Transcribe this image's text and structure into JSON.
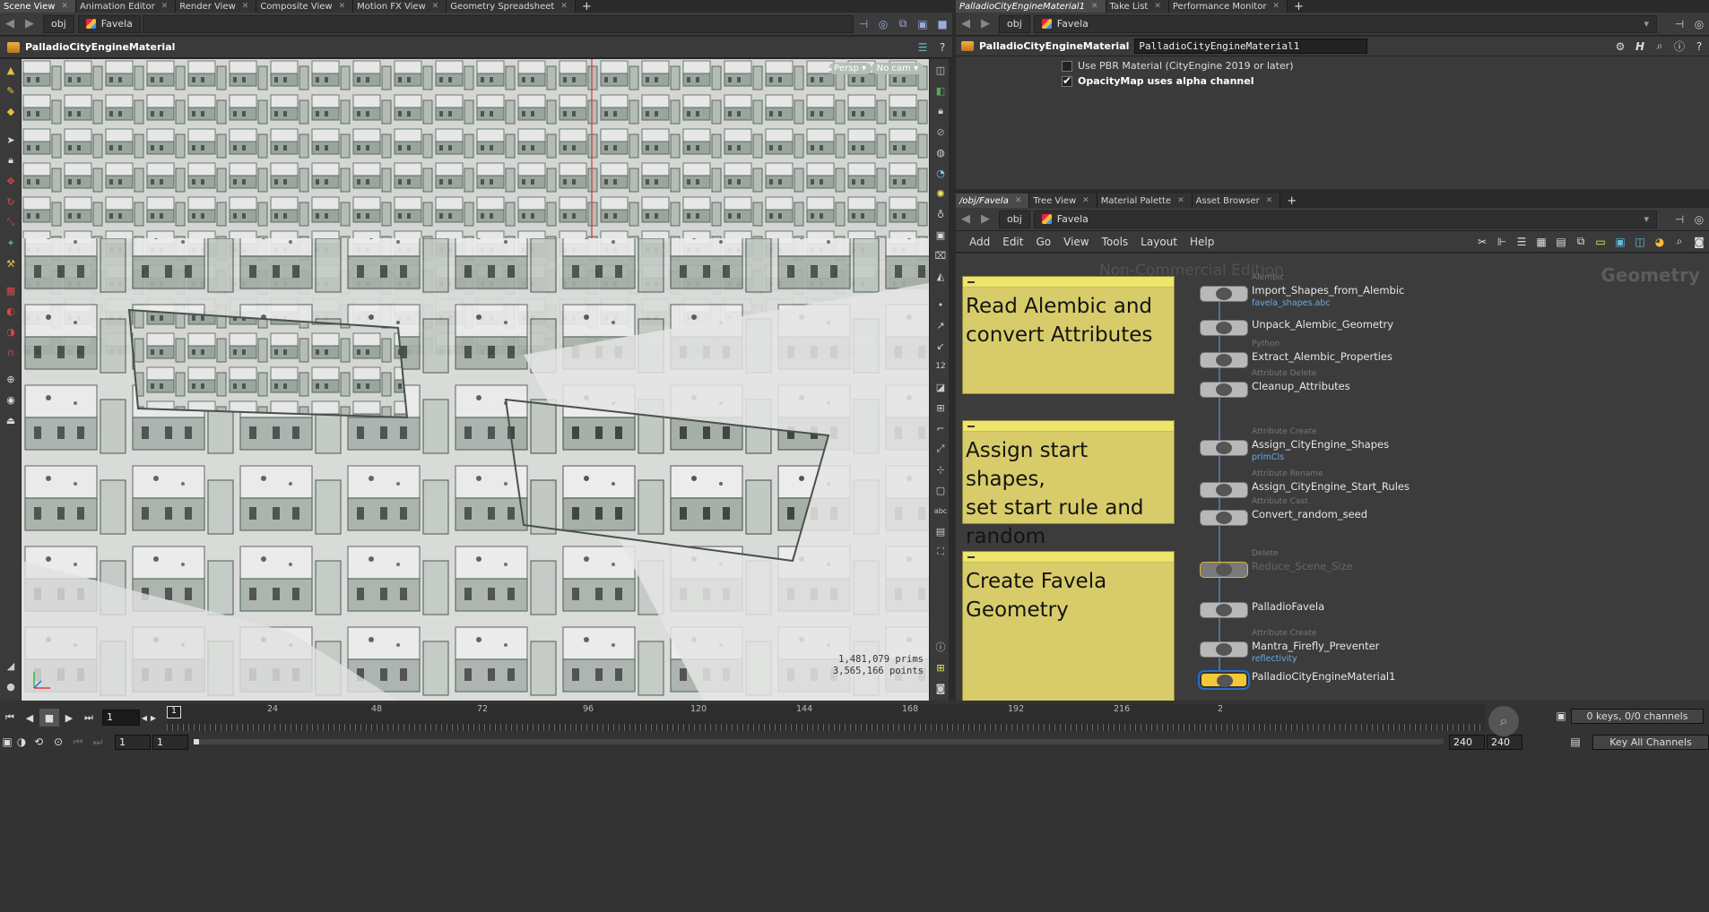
{
  "left_tabs": [
    {
      "label": "Scene View",
      "active": true
    },
    {
      "label": "Animation Editor"
    },
    {
      "label": "Render View"
    },
    {
      "label": "Composite View"
    },
    {
      "label": "Motion FX View"
    },
    {
      "label": "Geometry Spreadsheet"
    }
  ],
  "left_path": {
    "root": "obj",
    "node": "Favela"
  },
  "viewport": {
    "title": "PalladioCityEngineMaterial",
    "camera_mode": "Persp ▾",
    "camera": "No cam ▾",
    "prims": "1,481,079  prims",
    "points": "3,565,166 points"
  },
  "right_top_tabs": [
    {
      "label": "PalladioCityEngineMaterial1",
      "active": true,
      "italic": true
    },
    {
      "label": "Take List"
    },
    {
      "label": "Performance Monitor"
    }
  ],
  "right_top_path": {
    "root": "obj",
    "node": "Favela"
  },
  "params": {
    "node_type": "PalladioCityEngineMaterial",
    "node_name": "PalladioCityEngineMaterial1",
    "option1": "Use PBR Material (CityEngine 2019 or later)",
    "option1_checked": false,
    "option2": "OpacityMap uses alpha channel",
    "option2_checked": true
  },
  "network_tabs": [
    {
      "label": "/obj/Favela",
      "active": true,
      "italic": true
    },
    {
      "label": "Tree View"
    },
    {
      "label": "Material Palette"
    },
    {
      "label": "Asset Browser"
    }
  ],
  "network_path": {
    "root": "obj",
    "node": "Favela"
  },
  "network_menu": [
    "Add",
    "Edit",
    "Go",
    "View",
    "Tools",
    "Layout",
    "Help"
  ],
  "network": {
    "watermark": "Non-Commercial Edition",
    "context": "Geometry",
    "stickies": [
      {
        "text": "Read Alembic and\nconvert Attributes"
      },
      {
        "text": "Assign start shapes,\nset start rule and random\nseed"
      },
      {
        "text": "Create Favela Geometry"
      }
    ],
    "nodes": [
      {
        "type": "Alembic",
        "name": "Import_Shapes_from_Alembic",
        "sub": "favela_shapes.abc"
      },
      {
        "type": "",
        "name": "Unpack_Alembic_Geometry",
        "sub": ""
      },
      {
        "type": "Python",
        "name": "Extract_Alembic_Properties",
        "sub": ""
      },
      {
        "type": "Attribute Delete",
        "name": "Cleanup_Attributes",
        "sub": ""
      },
      {
        "type": "Attribute Create",
        "name": "Assign_CityEngine_Shapes",
        "sub": "primCls"
      },
      {
        "type": "Attribute Rename",
        "name": "Assign_CityEngine_Start_Rules",
        "sub": ""
      },
      {
        "type": "Attribute Cast",
        "name": "Convert_random_seed",
        "sub": ""
      },
      {
        "type": "Delete",
        "name": "Reduce_Scene_Size",
        "sub": ""
      },
      {
        "type": "",
        "name": "PalladioFavela",
        "sub": ""
      },
      {
        "type": "Attribute Create",
        "name": "Mantra_Firefly_Preventer",
        "sub": "reflectivity"
      },
      {
        "type": "",
        "name": "PalladioCityEngineMaterial1",
        "sub": ""
      }
    ]
  },
  "timeline": {
    "current_frame": "1",
    "ticks": [
      "24",
      "48",
      "72",
      "96",
      "120",
      "144",
      "168",
      "192",
      "216",
      "2"
    ],
    "marker": "1",
    "start": "1",
    "start2": "1",
    "end": "240",
    "end2": "240",
    "keys_label": "0 keys, 0/0 channels",
    "key_all": "Key All Channels"
  },
  "colors": {
    "accent": "#f2c836",
    "sticky": "#d8cc6a",
    "selection": "#2a6ec8"
  }
}
